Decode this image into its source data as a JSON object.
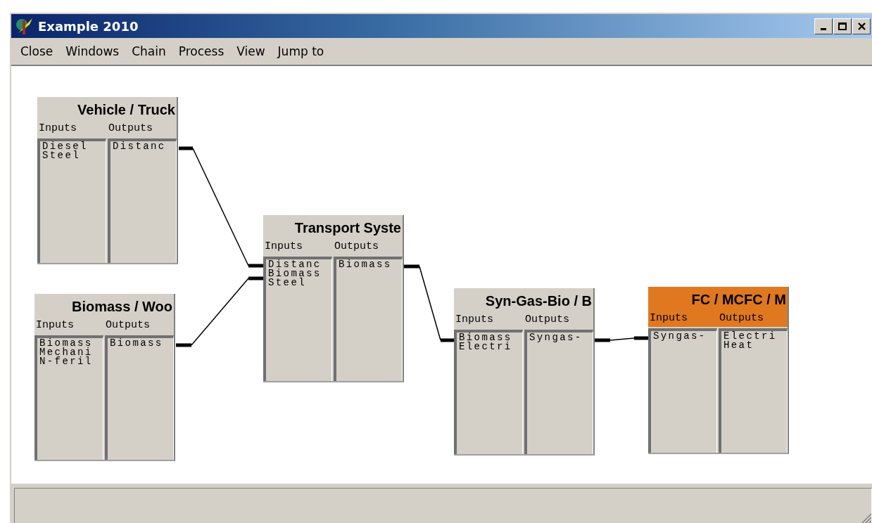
{
  "window": {
    "title": "Example 2010"
  },
  "menu": [
    "Close",
    "Windows",
    "Chain",
    "Process",
    "View",
    "Jump to"
  ],
  "nodes": [
    {
      "title": "Vehicle / Truck",
      "inputs_label": "Inputs",
      "outputs_label": "Outputs",
      "selected": false,
      "inputs": [
        "Diesel",
        "Steel"
      ],
      "outputs": [
        "Distanc"
      ]
    },
    {
      "title": "Biomass / Woo",
      "inputs_label": "Inputs",
      "outputs_label": "Outputs",
      "selected": false,
      "inputs": [
        "Biomass",
        "Mechani",
        "N-feril"
      ],
      "outputs": [
        "Biomass"
      ]
    },
    {
      "title": "Transport Syste",
      "inputs_label": "Inputs",
      "outputs_label": "Outputs",
      "selected": false,
      "inputs": [
        "Distanc",
        "Biomass",
        "Steel"
      ],
      "outputs": [
        "Biomass"
      ]
    },
    {
      "title": "Syn-Gas-Bio / B",
      "inputs_label": "Inputs",
      "outputs_label": "Outputs",
      "selected": false,
      "inputs": [
        "Biomass",
        "Electri"
      ],
      "outputs": [
        "Syngas-"
      ]
    },
    {
      "title": "FC / MCFC / M",
      "inputs_label": "Inputs",
      "outputs_label": "Outputs",
      "selected": true,
      "inputs": [
        "Syngas-"
      ],
      "outputs": [
        "Electri",
        "Heat"
      ]
    }
  ]
}
